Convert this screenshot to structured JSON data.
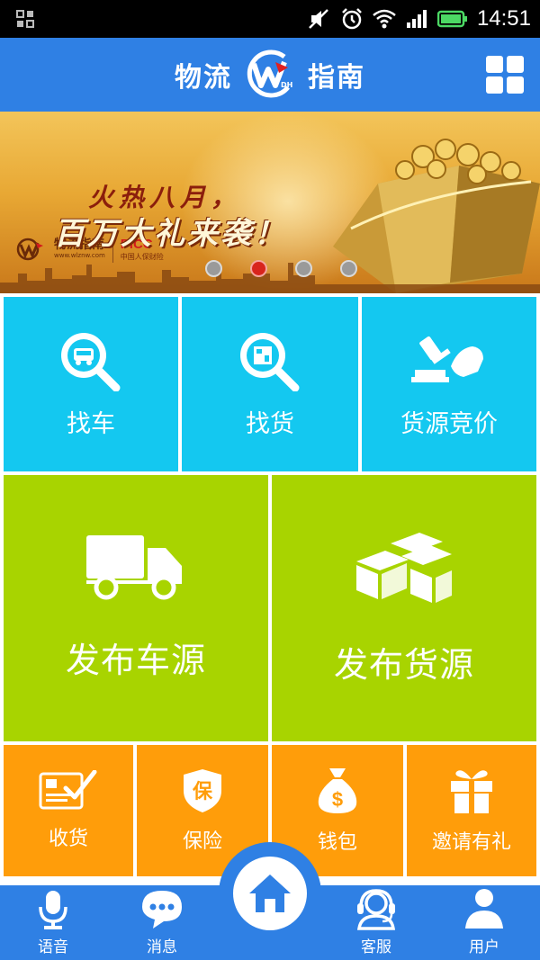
{
  "status_bar": {
    "time": "14:51"
  },
  "header": {
    "title_left": "物流",
    "title_right": "指南",
    "logo_badge": "DH"
  },
  "banner": {
    "brand": "物流指南",
    "url": "www.wlznw.com",
    "partner": "PICC",
    "partner_sub": "中国人保财险",
    "line1": "火热八月，",
    "line2": "百万大礼来袭！",
    "slide_count": 4,
    "active_slide": 2
  },
  "tiles_row1": [
    {
      "label": "找车",
      "icon": "search-truck-icon"
    },
    {
      "label": "找货",
      "icon": "search-goods-icon"
    },
    {
      "label": "货源竞价",
      "icon": "auction-hammer-icon"
    }
  ],
  "tiles_row2": [
    {
      "label": "发布车源",
      "icon": "truck-icon"
    },
    {
      "label": "发布货源",
      "icon": "boxes-icon"
    }
  ],
  "tiles_row3": [
    {
      "label": "收货",
      "icon": "receipt-check-icon"
    },
    {
      "label": "保险",
      "icon": "shield-insurance-icon",
      "glyph": "保"
    },
    {
      "label": "钱包",
      "icon": "money-bag-icon",
      "glyph": "$"
    },
    {
      "label": "邀请有礼",
      "icon": "gift-icon"
    }
  ],
  "bottom_nav": [
    {
      "label": "语音",
      "icon": "microphone-icon"
    },
    {
      "label": "消息",
      "icon": "chat-bubble-icon"
    },
    {
      "label": "",
      "icon": "home-icon"
    },
    {
      "label": "客服",
      "icon": "headset-icon"
    },
    {
      "label": "用户",
      "icon": "user-icon"
    }
  ],
  "colors": {
    "header_blue": "#2f80e4",
    "tile_blue": "#14c8f0",
    "tile_green": "#a8d400",
    "tile_orange": "#ff9d0a",
    "banner_gold": "#e8a834",
    "dot_active": "#d8241d"
  }
}
